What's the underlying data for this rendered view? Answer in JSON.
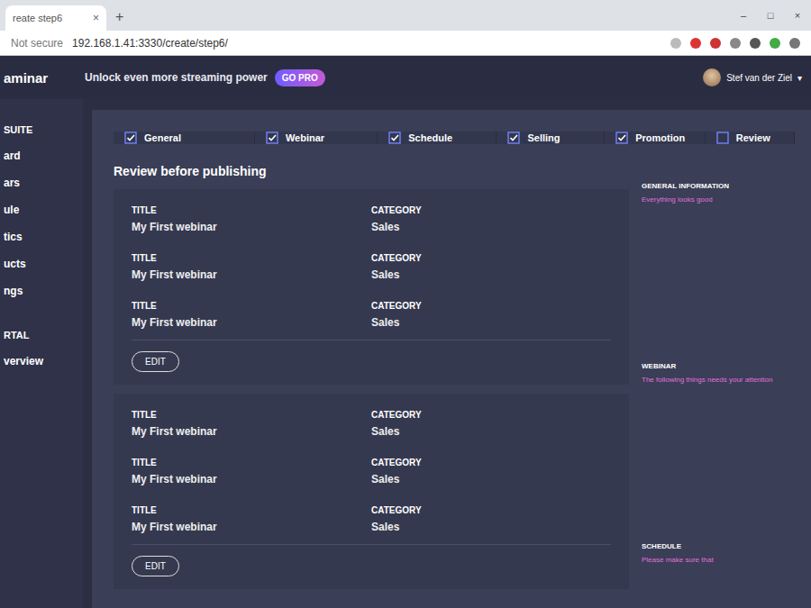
{
  "browser": {
    "tab_title": "reate step6",
    "tab_close": "×",
    "new_tab": "+",
    "window_controls": [
      "–",
      "□",
      "×"
    ],
    "security": "Not secure",
    "url": "192.168.1.41:3330/create/step6/"
  },
  "app": {
    "logo": "aminar",
    "promo": "Unlock even more streaming power",
    "go_pro": "GO PRO",
    "user": "Stef van der Ziel",
    "user_menu": "▾"
  },
  "sidebar": {
    "items": [
      {
        "label": "SUITE",
        "kind": "heading"
      },
      {
        "label": "ard",
        "kind": "link"
      },
      {
        "label": "ars",
        "kind": "link"
      },
      {
        "label": "ule",
        "kind": "link"
      },
      {
        "label": "tics",
        "kind": "link"
      },
      {
        "label": "ucts",
        "kind": "link"
      },
      {
        "label": "ngs",
        "kind": "link"
      },
      {
        "label": "RTAL",
        "kind": "heading"
      },
      {
        "label": "verview",
        "kind": "link"
      }
    ]
  },
  "steps": [
    {
      "label": "General",
      "checked": true
    },
    {
      "label": "Webinar",
      "checked": true
    },
    {
      "label": "Schedule",
      "checked": true
    },
    {
      "label": "Selling",
      "checked": true
    },
    {
      "label": "Promotion",
      "checked": true
    },
    {
      "label": "Review",
      "checked": false
    }
  ],
  "page_title": "Review before publishing",
  "cards": [
    {
      "rows": [
        {
          "label": "TITLE",
          "value": "My First webinar",
          "category_label": "CATEGORY",
          "category": "Sales"
        },
        {
          "label": "TITLE",
          "value": "My First webinar",
          "category_label": "CATEGORY",
          "category": "Sales"
        },
        {
          "label": "TITLE",
          "value": "My First webinar",
          "category_label": "CATEGORY",
          "category": "Sales"
        }
      ],
      "button": "EDIT"
    },
    {
      "rows": [
        {
          "label": "TITLE",
          "value": "My First webinar",
          "category_label": "CATEGORY",
          "category": "Sales"
        },
        {
          "label": "TITLE",
          "value": "My First webinar",
          "category_label": "CATEGORY",
          "category": "Sales"
        },
        {
          "label": "TITLE",
          "value": "My First webinar",
          "category_label": "CATEGORY",
          "category": "Sales"
        }
      ],
      "button": "EDIT"
    }
  ],
  "notes": [
    {
      "heading": "GENERAL INFORMATION",
      "message": "Everything looks good"
    },
    {
      "heading": "WEBINAR",
      "message": "The following things needs your attention"
    },
    {
      "heading": "SCHEDULE",
      "message": "Please make sure that"
    }
  ]
}
